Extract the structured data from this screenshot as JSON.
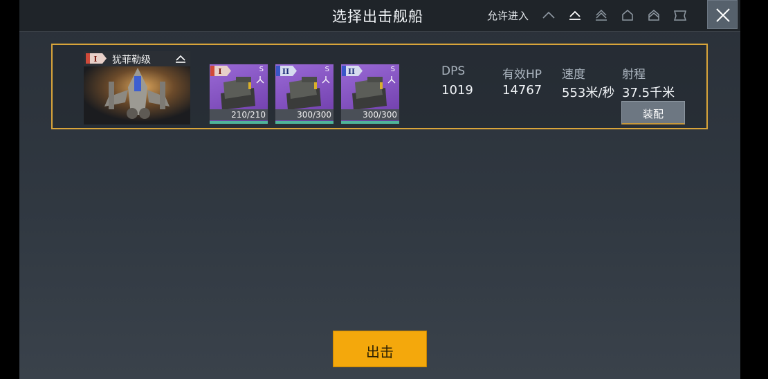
{
  "header": {
    "title": "选择出击舰船",
    "allow_label": "允许进入",
    "tier_icons": [
      "tier-1-icon",
      "tier-2-icon",
      "tier-3-icon",
      "tier-4-icon",
      "tier-5-icon",
      "tier-6-icon"
    ],
    "close_icon": "close-icon"
  },
  "ship": {
    "rank": "I",
    "name": "犹菲勒级",
    "weapons": [
      {
        "rank": "I",
        "size": "S",
        "ammo": "210/210"
      },
      {
        "rank": "II",
        "size": "S",
        "ammo": "300/300"
      },
      {
        "rank": "II",
        "size": "S",
        "ammo": "300/300"
      }
    ],
    "stats": {
      "dps_label": "DPS",
      "dps_value": "1019",
      "hp_label": "有效HP",
      "hp_value": "14767",
      "speed_label": "速度",
      "speed_value": "553米/秒",
      "range_label": "射程",
      "range_value": "37.5千米"
    },
    "equip_label": "装配"
  },
  "deploy_label": "出击",
  "colors": {
    "accent": "#d9a53a",
    "deploy": "#f4a80c",
    "weapon_bg": "#8a55c8",
    "ammo_bar": "#4fb39a"
  }
}
